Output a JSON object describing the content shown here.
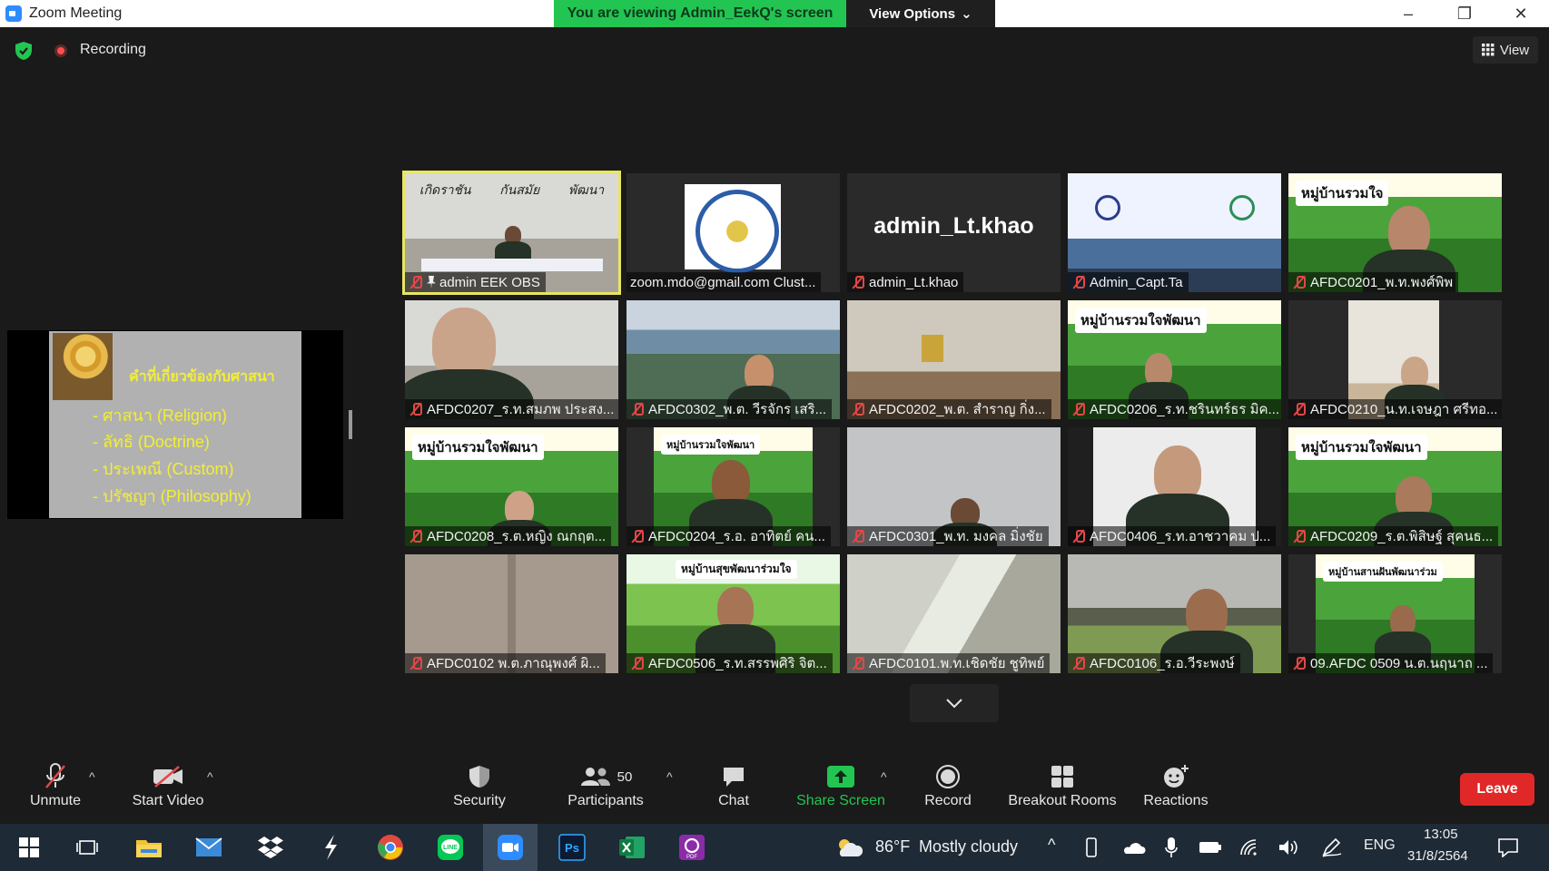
{
  "window": {
    "title": "Zoom Meeting",
    "viewing_banner": "You are viewing Admin_EekQ's screen",
    "view_options": "View Options",
    "controls": [
      "minimize-icon",
      "restore-icon",
      "close-icon"
    ]
  },
  "status": {
    "recording": "Recording",
    "view": "View"
  },
  "shared_slide": {
    "title": "คำที่เกี่ยวข้องกับศาสนา",
    "items": [
      "- ศาสนา (Religion)",
      "- ลัทธิ (Doctrine)",
      "- ประเพณี (Custom)",
      "- ปรัชญา (Philosophy)"
    ]
  },
  "gallery": {
    "tiles": [
      {
        "name": "admin EEK OBS",
        "top_label_1": "เกิดราชัน",
        "top_label_2": "กันสมัย",
        "top_label_3": "พัฒนา"
      },
      {
        "name": "zoom.mdo@gmail.com Clust..."
      },
      {
        "name": "admin_Lt.khao",
        "big": "admin_Lt.khao"
      },
      {
        "name": "Admin_Capt.Ta"
      },
      {
        "name": "AFDC0201_พ.ท.พงศ์พิพ",
        "banner": "หมู่บ้านรวมใจ"
      },
      {
        "name": "AFDC0207_ร.ท.สมภพ ประสง..."
      },
      {
        "name": "AFDC0302_พ.ต. วีรจักร เสริ..."
      },
      {
        "name": "AFDC0202_พ.ต. สำราญ กิ่ง..."
      },
      {
        "name": "AFDC0206_ร.ท.ชรินทร์ธร มิค...",
        "banner": "หมู่บ้านรวมใจพัฒนา"
      },
      {
        "name": "AFDC0210_น.ท.เจษฎา ศรีทอ..."
      },
      {
        "name": "AFDC0208_ร.ต.หญิง ณกฤต...",
        "banner": "หมู่บ้านรวมใจพัฒนา"
      },
      {
        "name": "AFDC0204_ร.อ. อาทิตย์ คน...",
        "banner": "หมู่บ้านรวมใจพัฒนา"
      },
      {
        "name": "AFDC0301_พ.ท. มงคล มิ่งชัย"
      },
      {
        "name": "AFDC0406_ร.ท.อาชวาคม ป..."
      },
      {
        "name": "AFDC0209_ร.ต.พิสิษฐ์ สุคนธ...",
        "banner": "หมู่บ้านรวมใจพัฒนา"
      },
      {
        "name": "AFDC0102 พ.ต.ภาณุพงศ์ ผิ..."
      },
      {
        "name": "AFDC0506_ร.ท.สรรพศิริ จิต...",
        "banner": "หมู่บ้านสุขพัฒนาร่วมใจ"
      },
      {
        "name": "AFDC0101.พ.ท.เชิดชัย ชูทิพย์"
      },
      {
        "name": "AFDC0106_ร.อ.วีระพงษ์"
      },
      {
        "name": "09.AFDC 0509 น.ต.นฤนาถ ...",
        "banner": "หมู่บ้านสานฝันพัฒนาร่วม"
      }
    ]
  },
  "toolbar": {
    "unmute": "Unmute",
    "start_video": "Start Video",
    "security": "Security",
    "participants": "Participants",
    "participants_count": "50",
    "chat": "Chat",
    "share_screen": "Share Screen",
    "record": "Record",
    "breakout_rooms": "Breakout Rooms",
    "reactions": "Reactions",
    "leave": "Leave"
  },
  "taskbar": {
    "weather_temp": "86°F",
    "weather_text": "Mostly cloudy",
    "lang": "ENG",
    "time": "13:05",
    "date": "31/8/2564",
    "apps": [
      "windows-start-icon",
      "task-view-icon",
      "file-explorer-icon",
      "mail-icon",
      "dropbox-icon",
      "thunder-icon",
      "chrome-icon",
      "line-icon",
      "zoom-icon",
      "photoshop-icon",
      "excel-icon",
      "pdf-icon"
    ]
  },
  "colors": {
    "accent_green": "#23c552",
    "leave_red": "#e02828",
    "active_speaker": "#e8e661"
  }
}
